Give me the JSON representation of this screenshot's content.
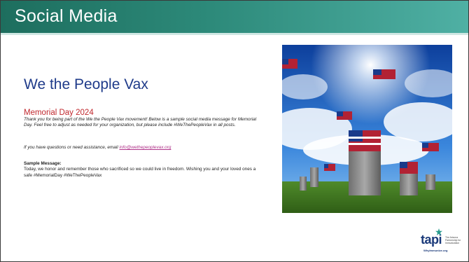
{
  "header": {
    "title": "Social Media"
  },
  "content": {
    "org_title": "We the People Vax",
    "event_title": "Memorial Day 2024",
    "intro": "Thank you for being part of the We the People Vax movement! Below is a sample social media message for Memorial Day. Feel free to adjust as needed for your organization, but please include #WeThePeopleVax in all posts.",
    "contact_prefix": "If you have questions or need assistance, email ",
    "contact_email": "info@wethepeoplevax.org",
    "sample_heading": "Sample Message:",
    "sample_text": "Today, we honor and remember those who sacrificed so we could live in freedom. Wishing you and your loved ones a safe #MemorialDay  #WeThePeopleVax"
  },
  "logo": {
    "word": "tapi",
    "tagline": "The Arizona Partnership for Immunization",
    "url": "WhyImmunize.org"
  },
  "colors": {
    "header_start": "#1d6e5e",
    "header_end": "#4fb0a4",
    "org_title": "#1f3b8a",
    "event_title": "#c0282e",
    "link": "#b0338a"
  }
}
